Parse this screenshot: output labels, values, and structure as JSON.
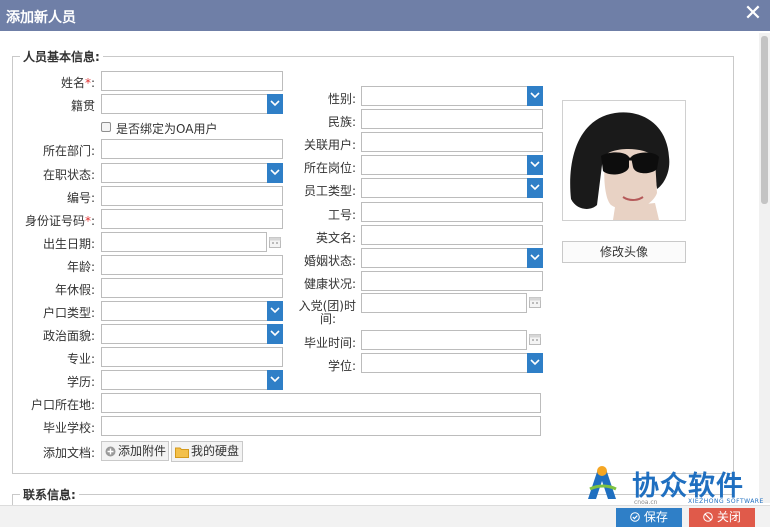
{
  "dialog": {
    "title": "添加新人员",
    "close_glyph": "✕"
  },
  "section_basic": "人员基本信息:",
  "section_contact": "联系信息:",
  "left": {
    "name_label": "姓名",
    "native_label": "籍贯",
    "bind_oa_label": "是否绑定为OA用户",
    "dept_label": "所在部门:",
    "status_label": "在职状态:",
    "number_label": "编号:",
    "idcard_label": "身份证号码",
    "birth_label": "出生日期:",
    "age_label": "年龄:",
    "leave_label": "年休假:",
    "hukou_type_label": "户口类型:",
    "politics_label": "政治面貌:",
    "major_label": "专业:",
    "edu_label": "学历:",
    "hukou_place_label": "户口所在地:",
    "school_label": "毕业学校:",
    "docs_label": "添加文档:"
  },
  "right": {
    "gender_label": "性别:",
    "ethnic_label": "民族:",
    "linked_user_label": "关联用户:",
    "post_label": "所在岗位:",
    "emp_type_label": "员工类型:",
    "job_no_label": "工号:",
    "english_label": "英文名:",
    "marital_label": "婚姻状态:",
    "health_label": "健康状况:",
    "party_label_1": "入党(团)时",
    "party_label_2": "间:",
    "grad_label": "毕业时间:",
    "degree_label": "学位:"
  },
  "required_mark": "*",
  "colon": ":",
  "avatar": {
    "change_label": "修改头像"
  },
  "buttons": {
    "attach": "添加附件",
    "disk": "我的硬盘",
    "save": "保存",
    "close": "关闭"
  },
  "logo": {
    "text": "协众软件",
    "sub": "XIEZHONG SOFTWARE",
    "url": "cnoa.cn"
  },
  "colors": {
    "titlebar": "#6f7fa7",
    "select_arrow": "#2f7fc7",
    "save": "#2f7fc7",
    "close": "#e05a4a"
  }
}
